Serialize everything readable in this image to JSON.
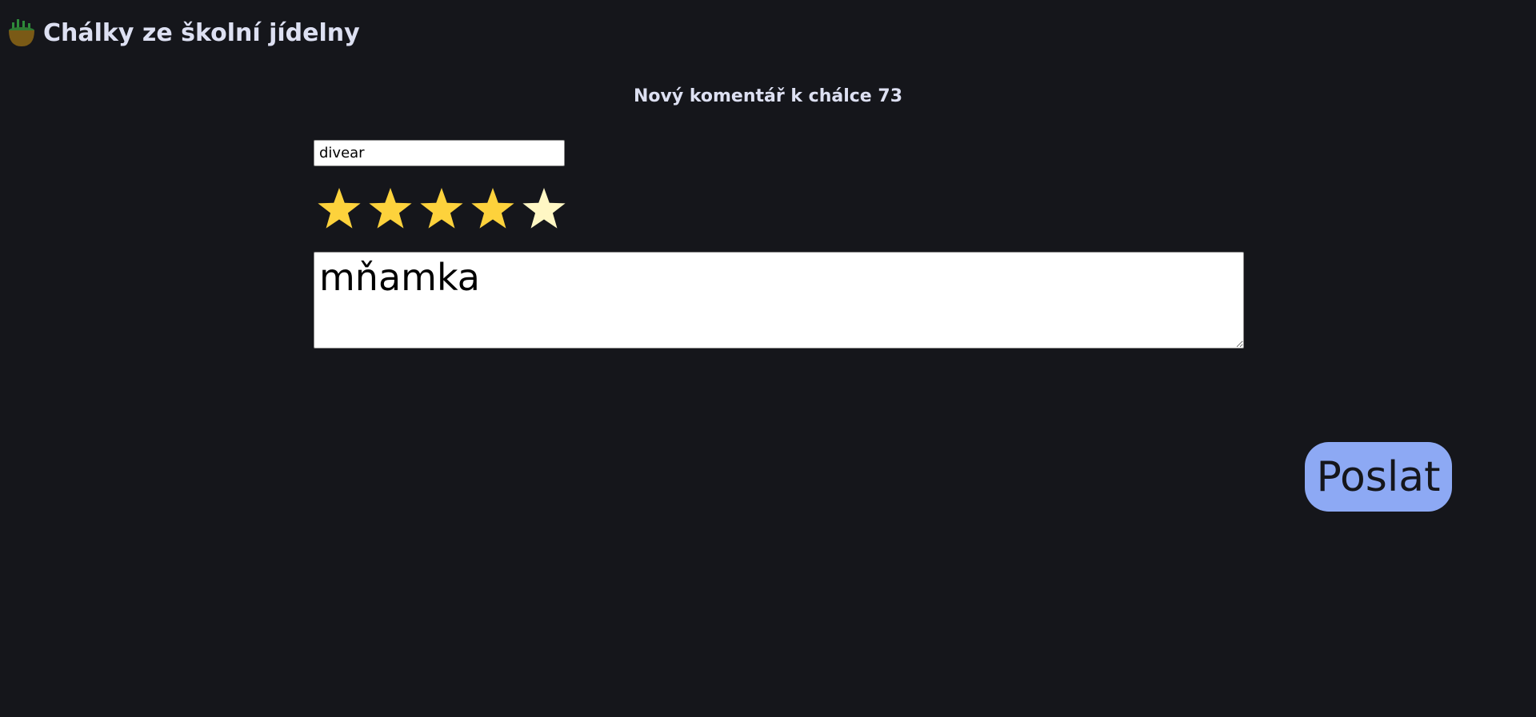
{
  "header": {
    "logo_icon": "food-bowl-icon",
    "site_title": "Chálky ze školní jídelny"
  },
  "form": {
    "title": "Nový komentář k chálce 73",
    "name_value": "divear",
    "rating": {
      "max": 5,
      "selected": 4,
      "filled_color": "#fdd23c",
      "empty_color": "#fff7c4",
      "icon": "star-icon"
    },
    "comment_value": "mňamka",
    "submit_label": "Poslat"
  },
  "colors": {
    "background": "#15161b",
    "text": "#dde0f2",
    "button": "#8da9f4"
  }
}
